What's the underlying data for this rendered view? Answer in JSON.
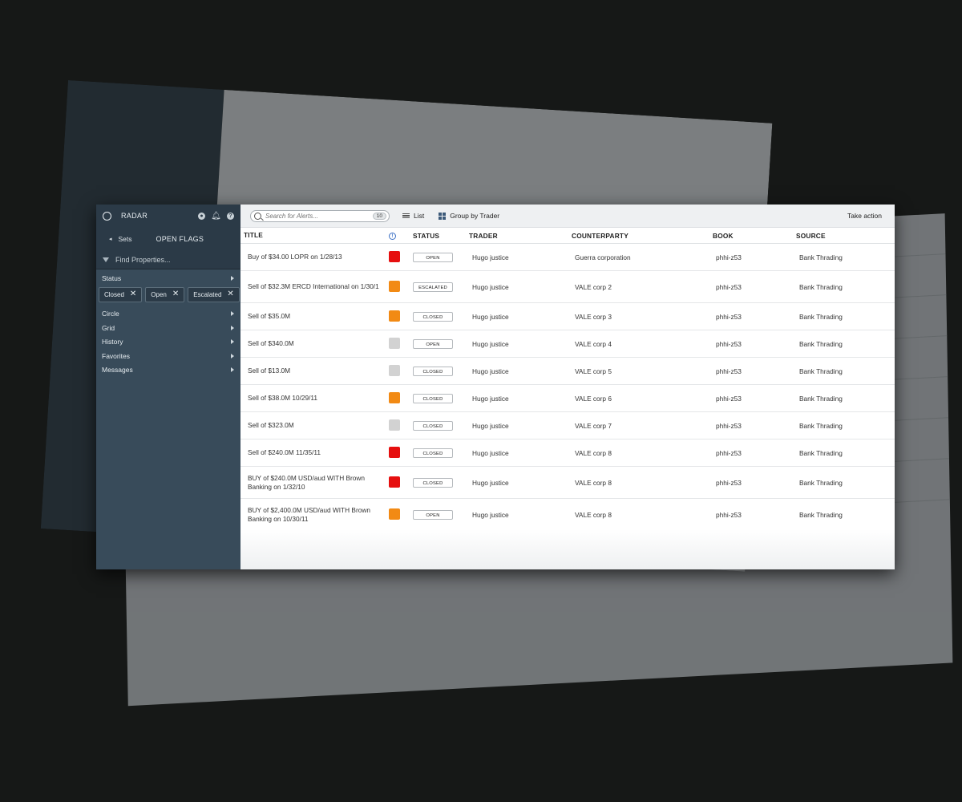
{
  "app": {
    "name": "RADAR"
  },
  "sidebar": {
    "back_label": "Sets",
    "section_title": "OPEN FLAGS",
    "find_placeholder": "Find Properties...",
    "status_label": "Status",
    "chips": [
      {
        "label": "Closed"
      },
      {
        "label": "Open"
      },
      {
        "label": "Escalated"
      }
    ],
    "items": [
      {
        "label": "Circle"
      },
      {
        "label": "Grid"
      },
      {
        "label": "History"
      },
      {
        "label": "Favorites"
      },
      {
        "label": "Messages"
      }
    ]
  },
  "toolbar": {
    "search_placeholder": "Search for Alerts...",
    "search_count": "10",
    "list_label": "List",
    "group_label": "Group by Trader",
    "take_action": "Take action"
  },
  "table": {
    "headers": {
      "title": "TITLE",
      "status": "STATUS",
      "trader": "TRADER",
      "counterparty": "COUNTERPARTY",
      "book": "BOOK",
      "source": "SOURCE"
    },
    "rows": [
      {
        "title": "Buy of $34.00 LOPR on 1/28/13",
        "flag": "#e60f0f",
        "status": "OPEN",
        "trader": "Hugo justice",
        "counterparty": "Guerra corporation",
        "book": "phhi-z53",
        "source": "Bank Thrading"
      },
      {
        "title": "Sell of $32.3M ERCD International on 1/30/1",
        "flag": "#f28a14",
        "status": "ESCALATED",
        "trader": "Hugo justice",
        "counterparty": "VALE corp 2",
        "book": "phhi-z53",
        "source": "Bank Thrading"
      },
      {
        "title": "Sell of $35.0M",
        "flag": "#f28a14",
        "status": "CLOSED",
        "trader": "Hugo justice",
        "counterparty": "VALE corp 3",
        "book": "phhi-z53",
        "source": "Bank Thrading"
      },
      {
        "title": "Sell of $340.0M",
        "flag": "#d2d2d2",
        "status": "OPEN",
        "trader": "Hugo justice",
        "counterparty": "VALE corp 4",
        "book": "phhi-z53",
        "source": "Bank Thrading"
      },
      {
        "title": "Sell of $13.0M",
        "flag": "#d2d2d2",
        "status": "CLOSED",
        "trader": "Hugo justice",
        "counterparty": "VALE corp 5",
        "book": "phhi-z53",
        "source": "Bank Thrading"
      },
      {
        "title": "Sell of $38.0M 10/29/11",
        "flag": "#f28a14",
        "status": "CLOSED",
        "trader": "Hugo justice",
        "counterparty": "VALE corp 6",
        "book": "phhi-z53",
        "source": "Bank Thrading"
      },
      {
        "title": "Sell of $323.0M",
        "flag": "#d2d2d2",
        "status": "CLOSED",
        "trader": "Hugo justice",
        "counterparty": "VALE corp 7",
        "book": "phhi-z53",
        "source": "Bank Thrading"
      },
      {
        "title": "Sell of $240.0M 11/35/11",
        "flag": "#e60f0f",
        "status": "CLOSED",
        "trader": "Hugo justice",
        "counterparty": "VALE corp 8",
        "book": "phhi-z53",
        "source": "Bank Thrading"
      },
      {
        "title": "BUY of $240.0M USD/aud WITH Brown Banking on 1/32/10",
        "flag": "#e60f0f",
        "status": "CLOSED",
        "trader": "Hugo justice",
        "counterparty": "VALE corp 8",
        "book": "phhi-z53",
        "source": "Bank Thrading"
      },
      {
        "title": "BUY of $2,400.0M USD/aud WITH Brown Banking on 10/30/11",
        "flag": "#f28a14",
        "status": "OPEN",
        "trader": "Hugo justice",
        "counterparty": "VALE corp 8",
        "book": "phhi-z53",
        "source": "Bank Thrading"
      }
    ]
  }
}
